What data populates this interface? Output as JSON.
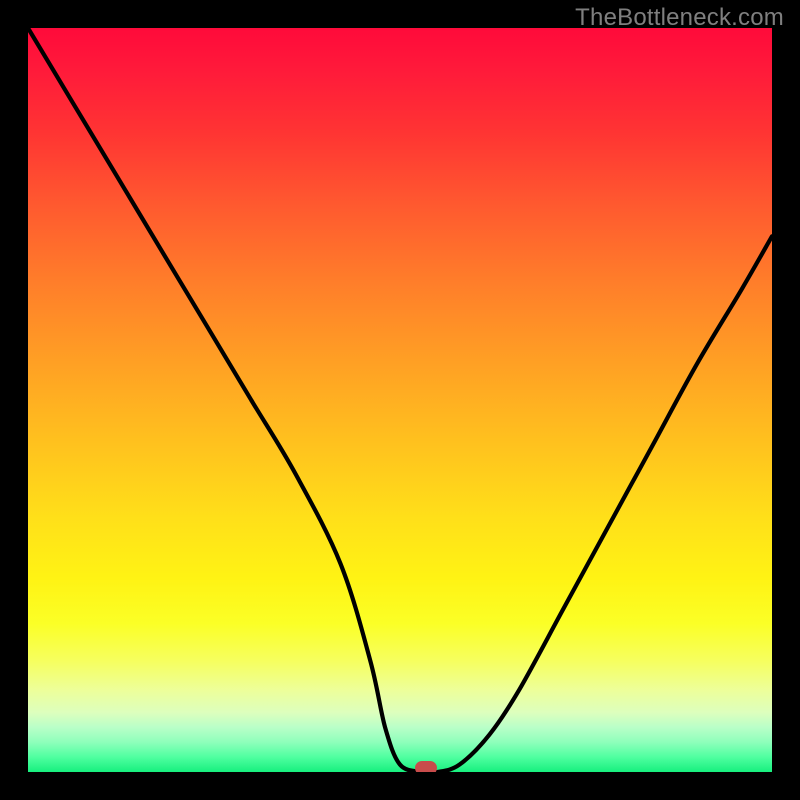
{
  "watermark": "TheBottleneck.com",
  "chart_data": {
    "type": "line",
    "title": "",
    "xlabel": "",
    "ylabel": "",
    "xlim": [
      0,
      100
    ],
    "ylim": [
      0,
      100
    ],
    "series": [
      {
        "name": "bottleneck-curve",
        "x": [
          0,
          6,
          12,
          18,
          24,
          30,
          36,
          42,
          46,
          48,
          50,
          53,
          55,
          58,
          62,
          66,
          72,
          78,
          84,
          90,
          96,
          100
        ],
        "y": [
          100,
          90,
          80,
          70,
          60,
          50,
          40,
          28,
          15,
          6,
          1,
          0,
          0,
          1,
          5,
          11,
          22,
          33,
          44,
          55,
          65,
          72
        ]
      }
    ],
    "marker": {
      "x": 53.5,
      "y": 0
    },
    "background": "vertical-gradient-red-yellow-green"
  },
  "colors": {
    "curve": "#000000",
    "dot": "#c84c4b",
    "frame": "#000000",
    "watermark": "#7f7f7f"
  }
}
